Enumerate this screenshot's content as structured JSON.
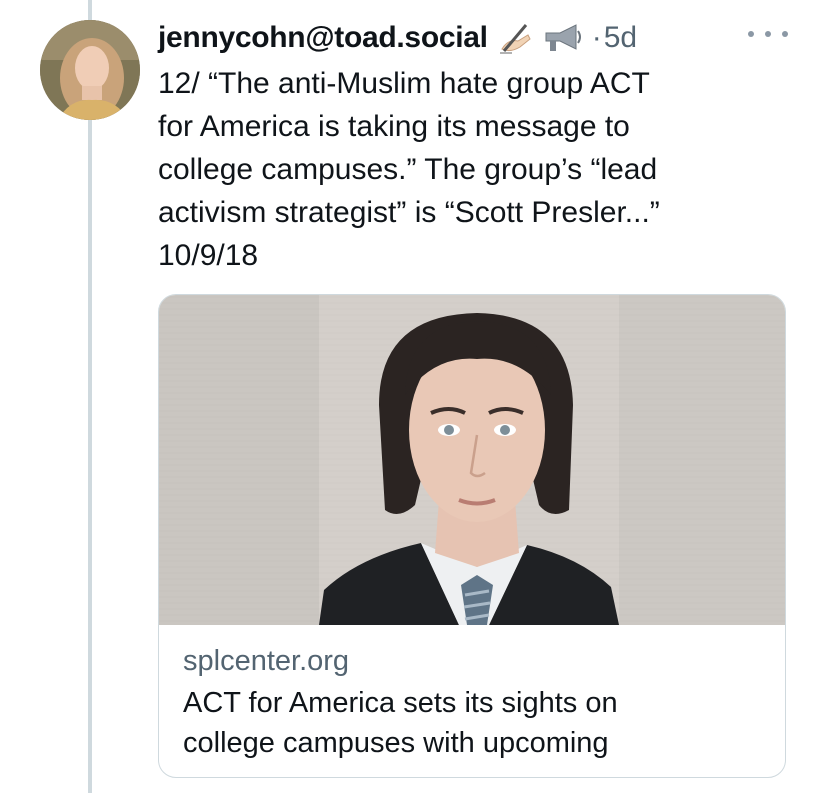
{
  "tweet": {
    "author": "jennycohn@toad.social",
    "time": "5d",
    "separator": "·",
    "text": "12/ “The anti-Muslim hate group ACT\nfor America is taking its message to\ncollege campuses.” The group’s “lead\nactivism strategist” is “Scott Presler...”\n10/9/18",
    "emoji_icons": [
      "writing-hand-icon",
      "megaphone-icon"
    ]
  },
  "card": {
    "domain": "splcenter.org",
    "title": "ACT for America sets its sights on\ncollege campuses with upcoming"
  },
  "colors": {
    "text": "#0f1419",
    "secondary": "#536471",
    "border": "#cfd9de"
  }
}
